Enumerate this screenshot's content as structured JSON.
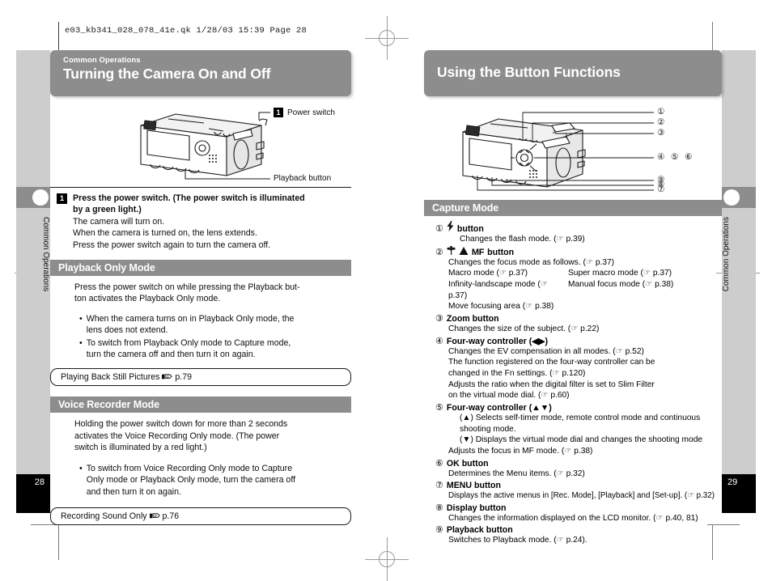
{
  "print_header": "e03_kb341_028_078_41e.qk  1/28/03  15:39  Page 28",
  "left_page": {
    "banner": {
      "subtitle": "Common Operations",
      "title": "Turning the Camera On and Off"
    },
    "figure": {
      "callout_number": "1",
      "callout_power": "Power switch",
      "callout_playback": "Playback button"
    },
    "step": {
      "number": "1",
      "bold_line1": "Press the power switch. (The power switch is illuminated",
      "bold_line2": "by a green light.)",
      "lines": [
        "The camera will turn on.",
        "When the camera is turned on, the lens extends.",
        "Press the power switch again to turn the camera off."
      ]
    },
    "playback_section": {
      "title": "Playback Only Mode",
      "paragraph_lines": [
        "Press the power switch on while pressing the Playback but-",
        "ton activates the Playback Only mode."
      ],
      "bullets": [
        [
          "When the camera turns on in Playback Only mode, the",
          "lens does not extend."
        ],
        [
          "To switch from Playback Only mode to Capture mode,",
          "turn the camera off and then turn it on again."
        ]
      ],
      "reference": {
        "text": "Playing Back Still Pictures",
        "page": "p.79"
      }
    },
    "voice_section": {
      "title": "Voice Recorder Mode",
      "paragraph_lines": [
        "Holding the power switch down for more than 2 seconds",
        "activates the Voice Recording Only mode. (The power",
        "switch is illuminated by a red light.)"
      ],
      "bullets": [
        [
          "To switch from Voice Recording Only mode to Capture",
          "Only mode or Playback Only mode, turn the camera off",
          "and then turn it on again."
        ]
      ],
      "reference": {
        "text": "Recording Sound Only",
        "page": "p.76"
      }
    },
    "side_tab": "Common Operations",
    "page_number": "28"
  },
  "right_page": {
    "banner": {
      "subtitle": "",
      "title": "Using the Button Functions"
    },
    "figure": {
      "callouts": [
        "①",
        "②",
        "③",
        "④",
        "⑤",
        "⑥",
        "⑨",
        "⑧",
        "⑦"
      ]
    },
    "capture_section": {
      "title": "Capture Mode"
    },
    "items": [
      {
        "num": "①",
        "icon": "flash-icon",
        "label": "button",
        "desc": [
          "Changes the flash mode. (☞ p.39)"
        ]
      },
      {
        "num": "②",
        "icon": "macro-landscape-mf-icons",
        "label": "button",
        "desc": [
          "Changes the focus mode as follows. (☞ p.37)"
        ],
        "two_col": [
          [
            "Macro mode (☞ p.37)",
            "Super macro mode (☞ p.37)"
          ],
          [
            "Infinity-landscape mode (☞ p.37)",
            "Manual focus mode (☞ p.38)"
          ]
        ],
        "desc_after": [
          "Move focusing area (☞ p.38)"
        ]
      },
      {
        "num": "③",
        "label": "Zoom button",
        "desc": [
          "Changes the size of the subject. (☞ p.22)"
        ]
      },
      {
        "num": "④",
        "label": "Four-way controller (◀▶)",
        "desc": [
          "Changes the EV compensation in all modes. (☞ p.52)",
          "The function registered on the four-way controller can be",
          "changed in the Fn settings. (☞ p.120)",
          "Adjusts the ratio when the digital filter is set to Slim Filter",
          "on the virtual mode dial. (☞ p.60)"
        ]
      },
      {
        "num": "⑤",
        "label": "Four-way controller (▲▼)",
        "desc": [
          "(▲) Selects self-timer mode, remote control mode and continuous",
          "shooting mode.",
          "(▼) Displays the virtual mode dial and changes the shooting mode",
          "Adjusts the focus in MF mode. (☞ p.38)"
        ]
      },
      {
        "num": "⑥",
        "label": "OK button",
        "desc": [
          "Determines the Menu items. (☞ p.32)"
        ]
      },
      {
        "num": "⑦",
        "label": "MENU button",
        "desc": [
          "Displays the active menus in [Rec. Mode], [Playback] and [Set-up]. (☞ p.32)"
        ]
      },
      {
        "num": "⑧",
        "label": "Display button",
        "desc": [
          "Changes the information displayed on the LCD monitor. (☞ p.40, 81)"
        ]
      },
      {
        "num": "⑨",
        "label": "Playback button",
        "desc": [
          "Switches to Playback mode. (☞ p.24)."
        ]
      }
    ],
    "side_tab": "Common Operations",
    "page_number": "29"
  }
}
